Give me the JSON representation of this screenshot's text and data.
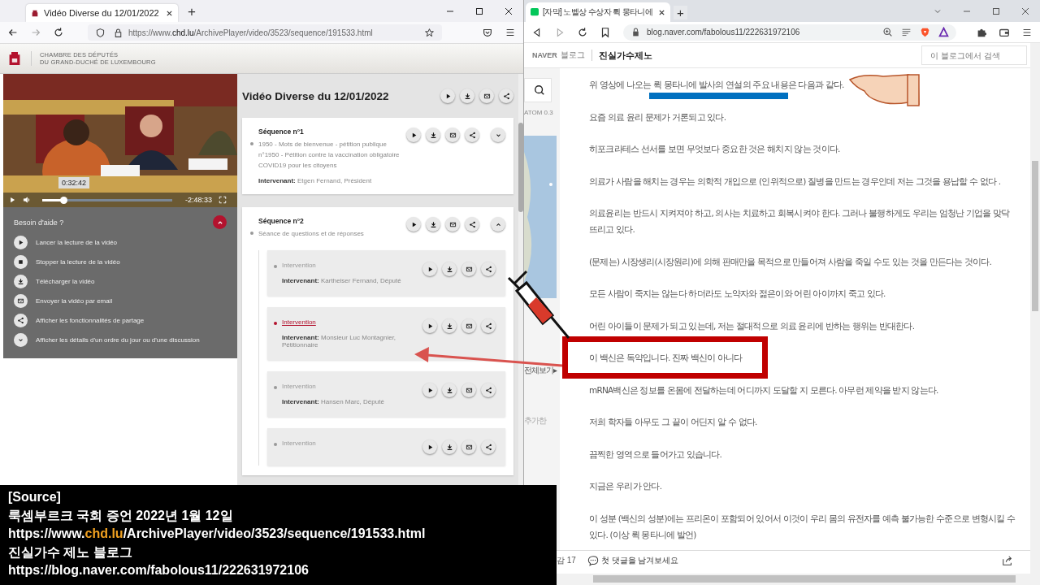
{
  "left_browser": {
    "tab_title": "Vidéo Diverse du 12/01/2022",
    "new_tab": "+",
    "url": "https://www.**chd.lu**/ArchivePlayer/video/3523/sequence/191533.html",
    "site_header": [
      "CHAMBRE DES DÉPUTÉS",
      "DU GRAND-DUCHÉ DE LUXEMBOURG"
    ],
    "video": {
      "time_tooltip": "0:32:42",
      "remaining": "-2:48:33",
      "level": 0.16
    },
    "help": {
      "title": "Besoin d'aide ?",
      "expanded": true,
      "items": [
        {
          "label": "Lancer la lecture de la vidéo"
        },
        {
          "label": "Stopper la lecture de la vidéo"
        },
        {
          "label": "Télécharger la vidéo"
        },
        {
          "label": "Envoyer la vidéo par email"
        },
        {
          "label": "Afficher les fonctionnalités de partage"
        },
        {
          "label": "Afficher les détails d'un ordre du jour ou d'une discussion"
        }
      ]
    },
    "main": {
      "title": "Vidéo Diverse du 12/01/2022",
      "sequences": [
        {
          "title": "Séquence n°1",
          "expanded": false,
          "description": "1950 - Mots de bienvenue - pétition publique n°1950 - Pétition contre la vaccination obligatoire COVID19 pour les citoyens",
          "speaker_label": "Intervenant:",
          "speaker": "Etgen Fernand, Président"
        },
        {
          "title": "Séquence n°2",
          "expanded": true,
          "description": "Séance de questions et de réponses",
          "interventions": [
            {
              "label": "Intervention",
              "selected": false,
              "speaker_label": "Intervenant:",
              "speaker": "Kartheiser Fernand, Député"
            },
            {
              "label": "Intervention",
              "selected": true,
              "speaker_label": "Intervenant:",
              "speaker": "Monsieur Luc Montagnier, Pétitionnaire"
            },
            {
              "label": "Intervention",
              "selected": false,
              "speaker_label": "Intervenant:",
              "speaker": "Hansen Marc, Député"
            },
            {
              "label": "Intervention",
              "selected": false
            }
          ]
        }
      ]
    }
  },
  "right_browser": {
    "tab_title": "[자막] 노벨상 수상자 뤽 몽타니에",
    "new_tab": "+",
    "url": "blog.naver.com/fabolous11/222631972106",
    "blog_header": {
      "brand": "NAVER",
      "section": "블로그",
      "blog_name": "진실가수제노",
      "search_placeholder": "이 블로그에서 검색"
    },
    "sidebar_fragments": [
      "ATOM 0.3",
      "전체보기▸",
      "추가한"
    ],
    "paragraphs": [
      {
        "text": "위 영상에 나오는 뤽 몽타니에 발사의 연설의 주요 내용은 다음과 같다.",
        "highlighted": false
      },
      {
        "text": "요즘 의료 윤리 문제가 거론되고 있다.",
        "highlighted": false
      },
      {
        "text": "히포크라테스 선서를 보면 무엇보다 중요한 것은 해치지 않는 것이다.",
        "highlighted": false
      },
      {
        "text": "의료가 사람을 해치는 경우는 의학적 개입으로 (인위적으로) 질병을 만드는 경우인데 저는 그것을 용납할 수 없다 .",
        "highlighted": false
      },
      {
        "text": "의료윤리는 반드시 지켜져야 하고, 의사는 치료하고 회복시켜야 한다. 그러나 불행하게도 우리는 엄청난 기업을 맞닥뜨리고 있다.",
        "highlighted": false
      },
      {
        "text": "(문제는) 시장생리(시장원리)에 의해 판매만을 목적으로 만들어져 사람을 죽일 수도 있는 것을 만든다는 것이다.",
        "highlighted": false
      },
      {
        "text": "모든 사람이 죽지는 않는다 하더라도 노약자와 젊은이와 어린 아이까지 죽고 있다.",
        "highlighted": false
      },
      {
        "text": "어린 아이들이 문제가 되고 있는데, 저는 절대적으로 의료 윤리에 반하는 행위는 반대한다.",
        "highlighted": false
      },
      {
        "text": "이 백신은 독약입니다. 진짜 백신이 아니다",
        "highlighted": true
      },
      {
        "text": "mRNA백신은 정보를 온몸에 전달하는데 어디까지 도달할 지 모른다. 아무런 제약을 받지 않는다.",
        "highlighted": false
      },
      {
        "text": "저희 학자들 아무도 그 끝이 어딘지 알 수 없다.",
        "highlighted": false
      },
      {
        "text": "끔찍한 영역으로 들어가고 있습니다.",
        "highlighted": false
      },
      {
        "text": "지금은 우리가 안다.",
        "highlighted": false
      },
      {
        "text": "이 성분 (백신의 성분)에는 프리온이 포함되어 있어서 이것이 우리 몸의 유전자를 예측 불가능한 수준으로 변형시킬 수 있다. (이상 뤽 몽타니에 발언)",
        "highlighted": false
      }
    ],
    "footer": {
      "likes": "감 17",
      "comment_prompt": "첫 댓글을 남겨보세요"
    }
  },
  "source_caption": [
    "[Source]",
    "룩셈부르크 국회 증언  2022년 1월 12일",
    "https://www.**chd.lu**/ArchivePlayer/video/3523/sequence/191533.html",
    "진실가수 제노 블로그",
    "https://blog.naver.com/fabolous11/222631972106"
  ]
}
